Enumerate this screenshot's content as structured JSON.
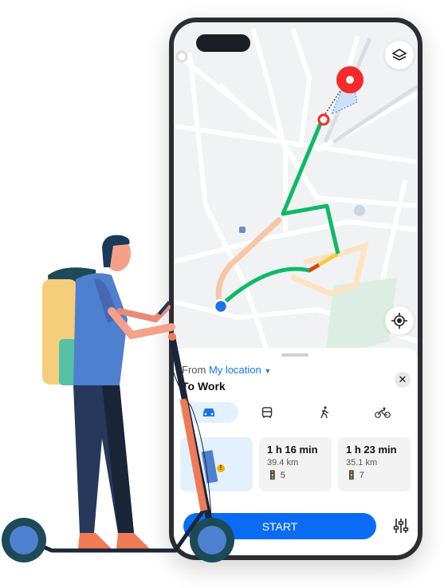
{
  "map": {
    "layers_icon": "layers-icon",
    "locate_icon": "my-location-icon",
    "route_colors": {
      "fast": "#10b965",
      "slow": "#f7c948",
      "jam": "#e8410c",
      "alt": "#f6c7a4"
    },
    "destination_color": "#f52a2a",
    "origin_color": "#1a73e8"
  },
  "sheet": {
    "from_label": "From",
    "from_value": "My location",
    "to_label": "To Work",
    "close_icon": "close-icon",
    "modes": [
      {
        "icon": "car-icon",
        "active": true
      },
      {
        "icon": "bus-icon",
        "active": false
      },
      {
        "icon": "walk-icon",
        "active": false
      },
      {
        "icon": "bike-icon",
        "active": false
      }
    ],
    "routes": [
      {
        "time": "1 h 16 min",
        "distance": "39.4 km",
        "lights": "5"
      },
      {
        "time": "1 h 23 min",
        "distance": "35.1 km",
        "lights": "7"
      }
    ],
    "warning_badge": "!",
    "start_label": "START",
    "filter_icon": "route-preferences-icon"
  },
  "colors": {
    "accent": "#0a6cf5"
  }
}
